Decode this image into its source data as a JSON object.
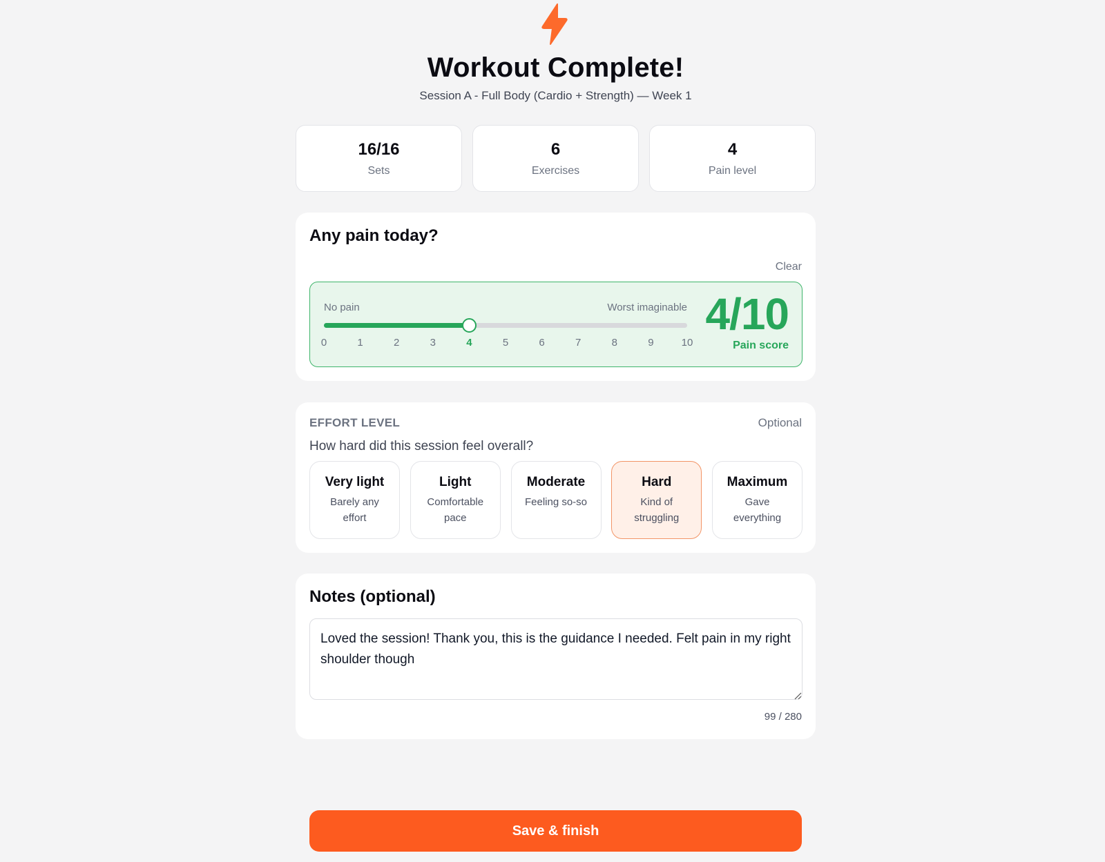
{
  "header": {
    "title": "Workout Complete!",
    "subtitle": "Session A - Full Body (Cardio + Strength) — Week 1",
    "logo_icon": "lightning-bolt-icon",
    "accent_color": "#fd5b1f"
  },
  "stats": [
    {
      "value": "16/16",
      "label": "Sets"
    },
    {
      "value": "6",
      "label": "Exercises"
    },
    {
      "value": "4",
      "label": "Pain level"
    }
  ],
  "pain": {
    "title": "Any pain today?",
    "clear_label": "Clear",
    "min_label": "No pain",
    "max_label": "Worst imaginable",
    "ticks": [
      "0",
      "1",
      "2",
      "3",
      "4",
      "5",
      "6",
      "7",
      "8",
      "9",
      "10"
    ],
    "value": 4,
    "max": 10,
    "score_text": "4/10",
    "score_label": "Pain score",
    "color": "#27a65a"
  },
  "effort": {
    "heading": "EFFORT LEVEL",
    "optional_label": "Optional",
    "question": "How hard did this session feel overall?",
    "options": [
      {
        "title": "Very light",
        "desc": "Barely any effort"
      },
      {
        "title": "Light",
        "desc": "Comfortable pace"
      },
      {
        "title": "Moderate",
        "desc": "Feeling so-so"
      },
      {
        "title": "Hard",
        "desc": "Kind of struggling"
      },
      {
        "title": "Maximum",
        "desc": "Gave everything"
      }
    ],
    "selected": "Hard"
  },
  "notes": {
    "title": "Notes (optional)",
    "value": "Loved the session! Thank you, this is the guidance I needed. Felt pain in my right shoulder though",
    "counter": "99 / 280"
  },
  "actions": {
    "save_label": "Save & finish"
  }
}
